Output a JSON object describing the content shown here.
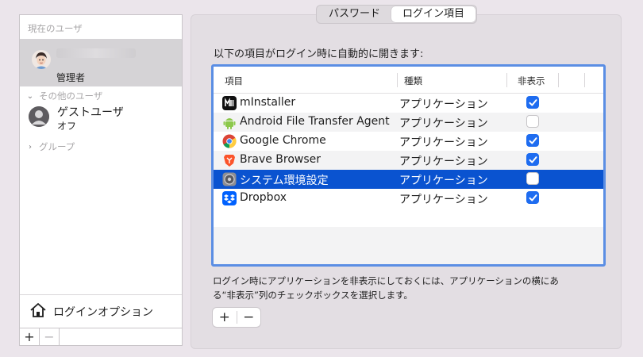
{
  "sidebar": {
    "current_users_header": "現在のユーザ",
    "current_user_role": "管理者",
    "other_users_header": "その他のユーザ",
    "guest": {
      "name": "ゲストユーザ",
      "status": "オフ"
    },
    "groups_header": "グループ",
    "login_options_label": "ログインオプション",
    "add_label": "+",
    "remove_label": "−"
  },
  "tabs": [
    {
      "label": "パスワード",
      "active": false
    },
    {
      "label": "ログイン項目",
      "active": true
    }
  ],
  "login_items": {
    "title": "以下の項目がログイン時に自動的に開きます:",
    "columns": {
      "item": "項目",
      "kind": "種類",
      "hide": "非表示"
    },
    "rows": [
      {
        "name": "mInstaller",
        "kind": "アプリケーション",
        "hidden": true,
        "icon": "minstaller-icon"
      },
      {
        "name": "Android File Transfer Agent",
        "kind": "アプリケーション",
        "hidden": false,
        "icon": "android-icon"
      },
      {
        "name": "Google Chrome",
        "kind": "アプリケーション",
        "hidden": true,
        "icon": "chrome-icon"
      },
      {
        "name": "Brave Browser",
        "kind": "アプリケーション",
        "hidden": true,
        "icon": "brave-icon"
      },
      {
        "name": "システム環境設定",
        "kind": "アプリケーション",
        "hidden": false,
        "icon": "system-preferences-icon",
        "selected": true
      },
      {
        "name": "Dropbox",
        "kind": "アプリケーション",
        "hidden": true,
        "icon": "dropbox-icon"
      }
    ],
    "hint_line1": "ログイン時にアプリケーションを非表示にしておくには、アプリケーションの横にあ",
    "hint_line2": "る“非表示”列のチェックボックスを選択します。",
    "add_label": "+",
    "remove_label": "−"
  },
  "colors": {
    "selection": "#0a53d0",
    "checkbox_on": "#1e6cf0",
    "focus_ring": "#5b8ee4"
  }
}
